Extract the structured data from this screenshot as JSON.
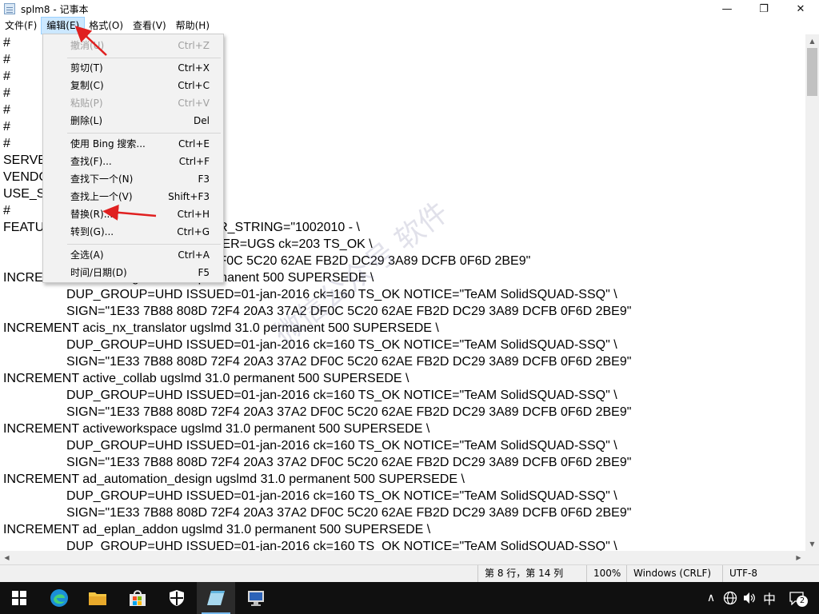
{
  "window": {
    "title": "splm8 - 记事本",
    "minimize_glyph": "—",
    "maximize_glyph": "❐",
    "close_glyph": "✕"
  },
  "menubar": {
    "file": "文件(F)",
    "edit": "编辑(E)",
    "format": "格式(O)",
    "view": "查看(V)",
    "help": "帮助(H)"
  },
  "edit_menu": {
    "undo": {
      "label": "撤消(U)",
      "shortcut": "Ctrl+Z"
    },
    "cut": {
      "label": "剪切(T)",
      "shortcut": "Ctrl+X"
    },
    "copy": {
      "label": "复制(C)",
      "shortcut": "Ctrl+C"
    },
    "paste": {
      "label": "粘贴(P)",
      "shortcut": "Ctrl+V"
    },
    "delete": {
      "label": "删除(L)",
      "shortcut": "Del"
    },
    "bing": {
      "label": "使用 Bing 搜索...",
      "shortcut": "Ctrl+E"
    },
    "find": {
      "label": "查找(F)...",
      "shortcut": "Ctrl+F"
    },
    "find_next": {
      "label": "查找下一个(N)",
      "shortcut": "F3"
    },
    "find_prev": {
      "label": "查找上一个(V)",
      "shortcut": "Shift+F3"
    },
    "replace": {
      "label": "替换(R)...",
      "shortcut": "Ctrl+H"
    },
    "goto": {
      "label": "转到(G)...",
      "shortcut": "Ctrl+G"
    },
    "select_all": {
      "label": "全选(A)",
      "shortcut": "Ctrl+A"
    },
    "time_date": {
      "label": "时间/日期(D)",
      "shortcut": "F5"
    }
  },
  "editor": {
    "lines": [
      "#",
      "#",
      "#",
      "#",
      "#",
      "#",
      "#",
      "SERVE                                    00",
      "VENDO",
      "USE_SI",
      "#",
      "FEATU                   rmanent 1 VENDOR_STRING=\"1002010 - \\",
      "                              =5555555555 ISSUER=UGS ck=203 TS_OK \\",
      "                              72F4 20A3 37A2 DF0C 5C20 62AE FB2D DC29 3A89 DCFB 0F6D 2BE9\"",
      "INCRE                         gslmd 31.0 permanent 500 SUPERSEDE \\",
      "DUP_GROUP=UHD ISSUED=01-jan-2016 ck=160 TS_OK NOTICE=\"TeAM SolidSQUAD-SSQ\" \\",
      "SIGN=\"1E33 7B88 808D 72F4 20A3 37A2 DF0C 5C20 62AE FB2D DC29 3A89 DCFB 0F6D 2BE9\"",
      "INCREMENT acis_nx_translator ugslmd 31.0 permanent 500 SUPERSEDE \\",
      "DUP_GROUP=UHD ISSUED=01-jan-2016 ck=160 TS_OK NOTICE=\"TeAM SolidSQUAD-SSQ\" \\",
      "SIGN=\"1E33 7B88 808D 72F4 20A3 37A2 DF0C 5C20 62AE FB2D DC29 3A89 DCFB 0F6D 2BE9\"",
      "INCREMENT active_collab ugslmd 31.0 permanent 500 SUPERSEDE \\",
      "DUP_GROUP=UHD ISSUED=01-jan-2016 ck=160 TS_OK NOTICE=\"TeAM SolidSQUAD-SSQ\" \\",
      "SIGN=\"1E33 7B88 808D 72F4 20A3 37A2 DF0C 5C20 62AE FB2D DC29 3A89 DCFB 0F6D 2BE9\"",
      "INCREMENT activeworkspace ugslmd 31.0 permanent 500 SUPERSEDE \\",
      "DUP_GROUP=UHD ISSUED=01-jan-2016 ck=160 TS_OK NOTICE=\"TeAM SolidSQUAD-SSQ\" \\",
      "SIGN=\"1E33 7B88 808D 72F4 20A3 37A2 DF0C 5C20 62AE FB2D DC29 3A89 DCFB 0F6D 2BE9\"",
      "INCREMENT ad_automation_design ugslmd 31.0 permanent 500 SUPERSEDE \\",
      "DUP_GROUP=UHD ISSUED=01-jan-2016 ck=160 TS_OK NOTICE=\"TeAM SolidSQUAD-SSQ\" \\",
      "SIGN=\"1E33 7B88 808D 72F4 20A3 37A2 DF0C 5C20 62AE FB2D DC29 3A89 DCFB 0F6D 2BE9\"",
      "INCREMENT ad_eplan_addon ugslmd 31.0 permanent 500 SUPERSEDE \\",
      "DUP_GROUP=UHD ISSUED=01-jan-2016 ck=160 TS_OK NOTICE=\"TeAM SolidSQUAD-SSQ\" \\"
    ]
  },
  "watermark": "微信公众号 软件",
  "statusbar": {
    "position": "第 8 行，第 14 列",
    "zoom": "100%",
    "line_ending": "Windows (CRLF)",
    "encoding": "UTF-8"
  },
  "taskbar": {
    "tray_chevron": "∧",
    "ime": "中",
    "notification_count": "2"
  },
  "colors": {
    "menu_highlight": "#cce8ff",
    "annotation_arrow": "#e02020",
    "taskbar_bg": "#101010"
  }
}
